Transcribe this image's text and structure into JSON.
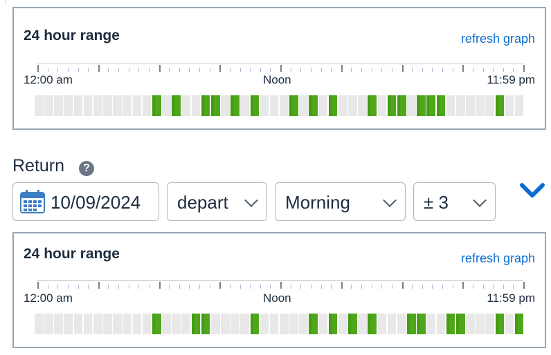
{
  "depart_graph": {
    "title": "24 hour range",
    "refresh": "refresh graph",
    "axis": {
      "start": "12:00 am",
      "noon": "Noon",
      "end": "11:59 pm"
    },
    "slots_on": [
      0,
      0,
      0,
      0,
      0,
      0,
      0,
      0,
      0,
      0,
      0,
      0,
      1,
      0,
      1,
      0,
      0,
      1,
      1,
      0,
      1,
      0,
      1,
      0,
      0,
      0,
      1,
      0,
      1,
      0,
      1,
      0,
      0,
      0,
      1,
      0,
      1,
      1,
      0,
      1,
      1,
      1,
      0,
      0,
      0,
      0,
      0,
      1,
      0,
      0
    ]
  },
  "return_section": {
    "label": "Return",
    "help_icon": "help-icon",
    "date": "10/09/2024",
    "depart_mode": "depart",
    "time_of_day": "Morning",
    "range": "± 3",
    "expand_icon": "chevron-down-icon"
  },
  "return_graph": {
    "title": "24 hour range",
    "refresh": "refresh graph",
    "axis": {
      "start": "12:00 am",
      "noon": "Noon",
      "end": "11:59 pm"
    },
    "slots_on": [
      0,
      0,
      0,
      0,
      0,
      0,
      0,
      0,
      0,
      0,
      0,
      0,
      1,
      0,
      0,
      0,
      1,
      1,
      0,
      0,
      0,
      0,
      1,
      0,
      0,
      0,
      0,
      0,
      1,
      0,
      1,
      0,
      1,
      0,
      1,
      0,
      0,
      0,
      1,
      1,
      0,
      0,
      1,
      1,
      0,
      0,
      0,
      1,
      0,
      1
    ]
  },
  "colors": {
    "accent": "#0a6ed1",
    "bar_on": "#4fa61a",
    "bar_off": "#e8e8e8",
    "border": "#9aa7b3"
  }
}
